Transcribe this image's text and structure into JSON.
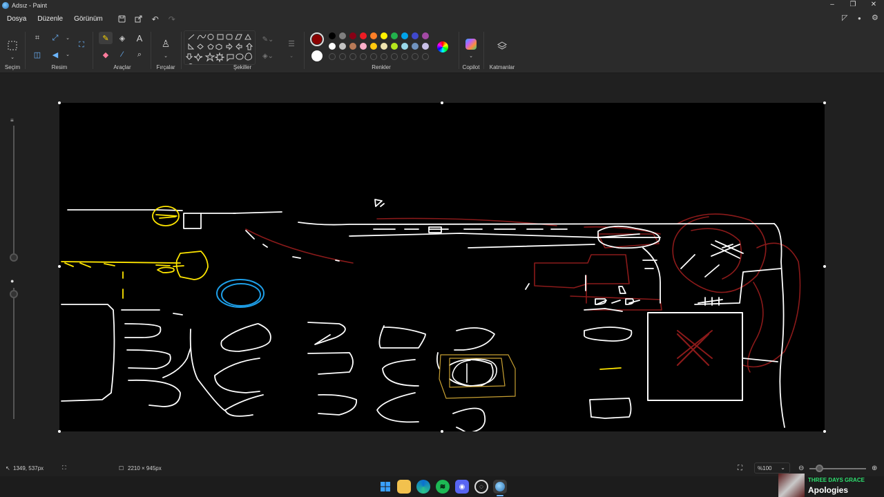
{
  "window": {
    "title": "Adsız - Paint"
  },
  "menu": {
    "file": "Dosya",
    "edit": "Düzenle",
    "view": "Görünüm"
  },
  "ribbon": {
    "selection": "Seçim",
    "image": "Resim",
    "tools": "Araçlar",
    "brushes": "Fırçalar",
    "shapes": "Şekiller",
    "colors": "Renkler",
    "copilot": "Copilot",
    "layers": "Katmanlar"
  },
  "palette": {
    "primary": "#8b0000",
    "secondary": "#ffffff",
    "row1": [
      "#000000",
      "#7f7f7f",
      "#880015",
      "#ed1c24",
      "#ff7f27",
      "#fff200",
      "#22b14c",
      "#00a2e8",
      "#3f48cc",
      "#a349a4"
    ],
    "row2": [
      "#ffffff",
      "#c3c3c3",
      "#b97a57",
      "#ffaec9",
      "#ffc90e",
      "#efe4b0",
      "#b5e61d",
      "#99d9ea",
      "#7092be",
      "#c8bfe7"
    ]
  },
  "status": {
    "cursor": "1349, 537px",
    "canvas_size": "2210 × 945px",
    "zoom": "%100"
  },
  "media": {
    "artist": "THREE DAYS GRACE",
    "song": "Apologies"
  }
}
